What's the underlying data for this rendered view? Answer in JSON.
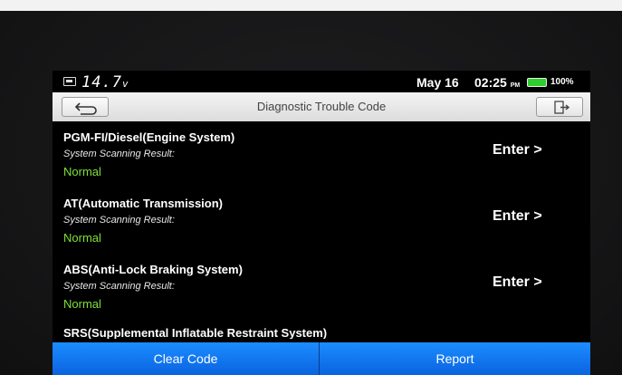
{
  "status": {
    "voltage": "14.7",
    "voltage_unit": "v",
    "date": "May 16",
    "time": "02:25",
    "ampm": "PM",
    "battery_pct": "100%"
  },
  "header": {
    "title": "Diagnostic Trouble Code"
  },
  "systems": [
    {
      "name": "PGM-FI/Diesel(Engine System)",
      "result_label": "System Scanning Result:",
      "result": "Normal",
      "action": "Enter >"
    },
    {
      "name": "AT(Automatic Transmission)",
      "result_label": "System Scanning Result:",
      "result": "Normal",
      "action": "Enter >"
    },
    {
      "name": "ABS(Anti-Lock Braking System)",
      "result_label": "System Scanning Result:",
      "result": "Normal",
      "action": "Enter >"
    },
    {
      "name": "SRS(Supplemental Inflatable Restraint System)"
    }
  ],
  "footer": {
    "clear_label": "Clear Code",
    "report_label": "Report"
  },
  "colors": {
    "accent": "#1577f0",
    "normal": "#7ee038",
    "titlebar": "#e8e8e8"
  }
}
